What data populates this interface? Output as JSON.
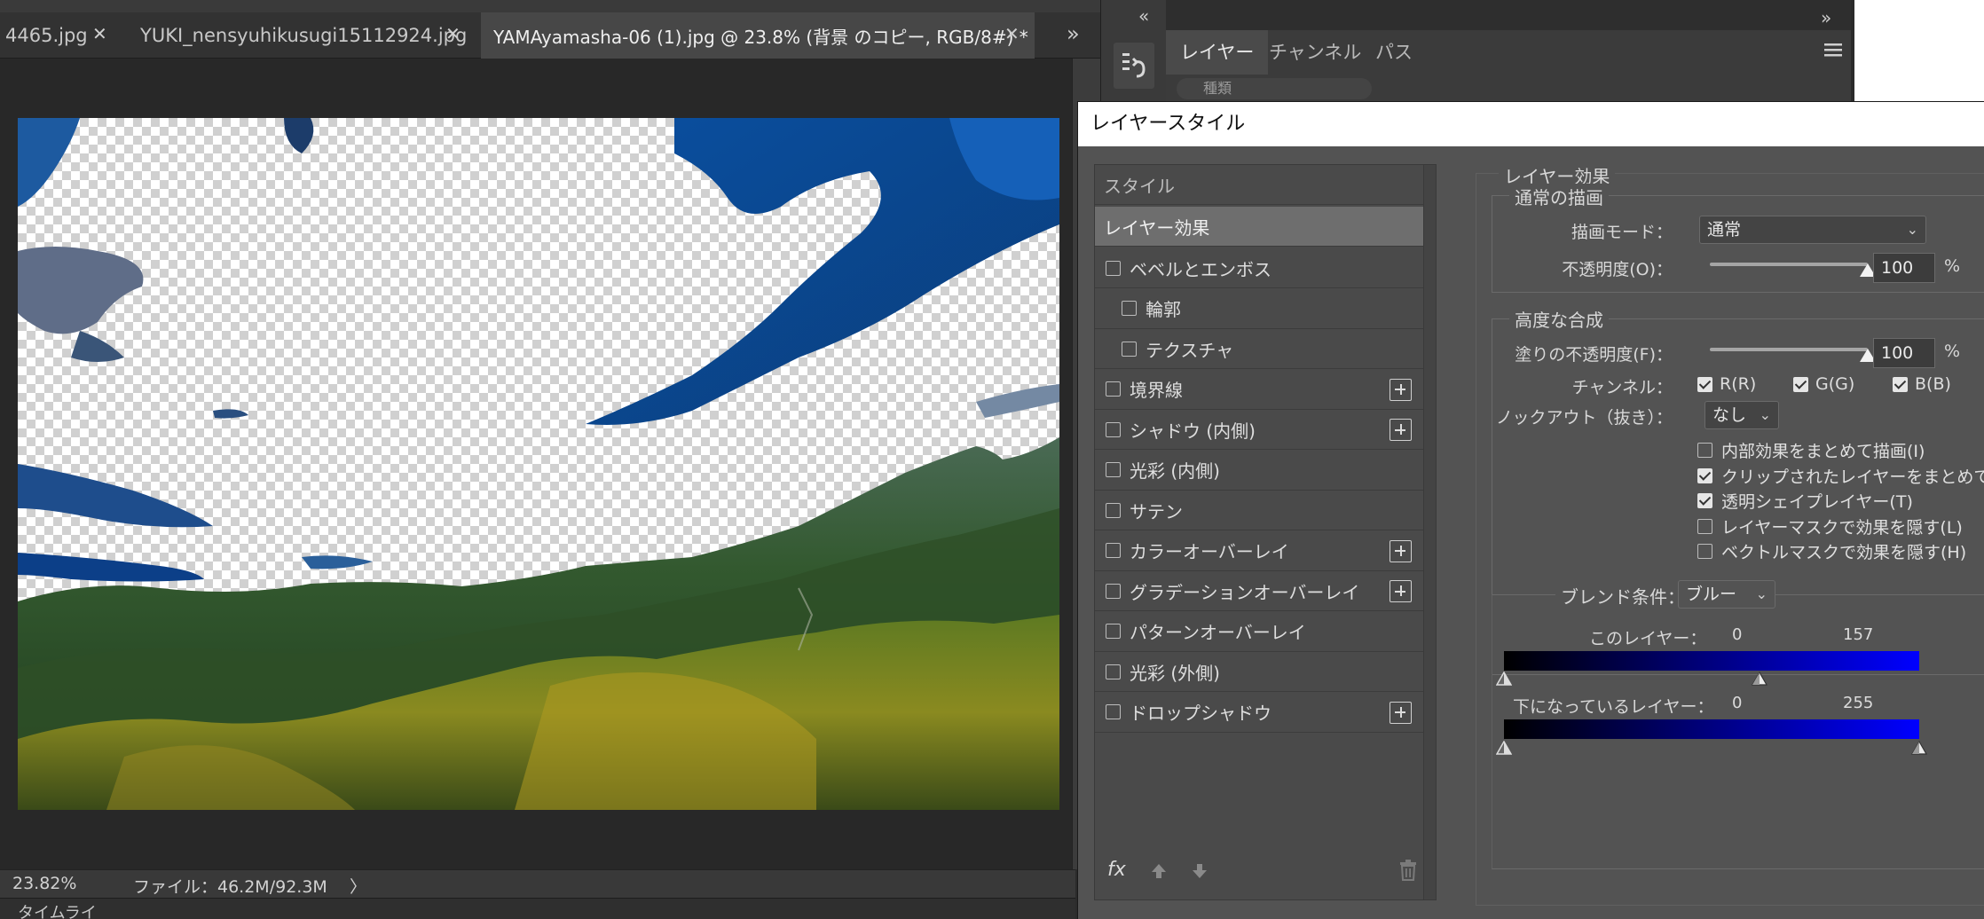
{
  "document_tabs": [
    {
      "label": "4465.jpg",
      "active": false
    },
    {
      "label": "YUKI_nensyuhikusugi15112924.jpg",
      "active": false
    },
    {
      "label": "YAMAyamasha-06 (1).jpg @ 23.8% (背景 のコピー, RGB/8#) *",
      "active": true
    }
  ],
  "tab_overflow": "»",
  "close_glyph": "✕",
  "status": {
    "zoom": "23.82%",
    "file_info": "ファイル：46.2M/92.3M",
    "arrow": "〉"
  },
  "timeline_label": "タイムライ",
  "panel": {
    "collapse_left": "«",
    "collapse_right": "»",
    "tabs": [
      "レイヤー",
      "チャンネル",
      "パス"
    ],
    "menu_icon": "hamburger-icon",
    "search_placeholder": "種類"
  },
  "dialog": {
    "title": "レイヤースタイル",
    "style_list": [
      {
        "label": "スタイル",
        "type": "header"
      },
      {
        "label": "レイヤー効果",
        "type": "selected"
      },
      {
        "label": "ベベルとエンボス",
        "checked": false,
        "indent": false,
        "plus": false
      },
      {
        "label": "輪郭",
        "checked": false,
        "indent": true,
        "plus": false
      },
      {
        "label": "テクスチャ",
        "checked": false,
        "indent": true,
        "plus": false
      },
      {
        "label": "境界線",
        "checked": false,
        "indent": false,
        "plus": true
      },
      {
        "label": "シャドウ (内側)",
        "checked": false,
        "indent": false,
        "plus": true
      },
      {
        "label": "光彩 (内側)",
        "checked": false,
        "indent": false,
        "plus": false
      },
      {
        "label": "サテン",
        "checked": false,
        "indent": false,
        "plus": false
      },
      {
        "label": "カラーオーバーレイ",
        "checked": false,
        "indent": false,
        "plus": true
      },
      {
        "label": "グラデーションオーバーレイ",
        "checked": false,
        "indent": false,
        "plus": true
      },
      {
        "label": "パターンオーバーレイ",
        "checked": false,
        "indent": false,
        "plus": false
      },
      {
        "label": "光彩 (外側)",
        "checked": false,
        "indent": false,
        "plus": false
      },
      {
        "label": "ドロップシャドウ",
        "checked": false,
        "indent": false,
        "plus": true
      }
    ],
    "footer": {
      "fx": "fx",
      "up_icon": "arrow-up-icon",
      "down_icon": "arrow-down-icon",
      "trash_icon": "trash-icon"
    },
    "layer_effects": {
      "legend": "レイヤー効果",
      "normal": {
        "legend": "通常の描画",
        "blend_mode_label": "描画モード：",
        "blend_mode_value": "通常",
        "opacity_label": "不透明度(O)：",
        "opacity_value": "100",
        "opacity_fraction": 1.0,
        "percent": "%"
      },
      "advanced": {
        "legend": "高度な合成",
        "fill_opacity_label": "塗りの不透明度(F)：",
        "fill_opacity_value": "100",
        "fill_opacity_fraction": 1.0,
        "percent": "%",
        "channels_label": "チャンネル：",
        "channels": [
          {
            "label": "R(R)",
            "checked": true
          },
          {
            "label": "G(G)",
            "checked": true
          },
          {
            "label": "B(B)",
            "checked": true
          }
        ],
        "knockout_label": "ノックアウト（抜き）：",
        "knockout_value": "なし",
        "options": [
          {
            "label": "内部効果をまとめて描画(I)",
            "checked": false
          },
          {
            "label": "クリップされたレイヤーをまとめて描画",
            "checked": true
          },
          {
            "label": "透明シェイプレイヤー(T)",
            "checked": true
          },
          {
            "label": "レイヤーマスクで効果を隠す(L)",
            "checked": false
          },
          {
            "label": "ベクトルマスクで効果を隠す(H)",
            "checked": false
          }
        ]
      },
      "blend_if": {
        "label": "ブレンド条件：",
        "value": "ブルー",
        "this_layer_label": "このレイヤー：",
        "this_layer_low": "0",
        "this_layer_high": "157",
        "underlying_label": "下になっているレイヤー：",
        "underlying_low": "0",
        "underlying_high": "255",
        "range_max": 255
      }
    }
  }
}
